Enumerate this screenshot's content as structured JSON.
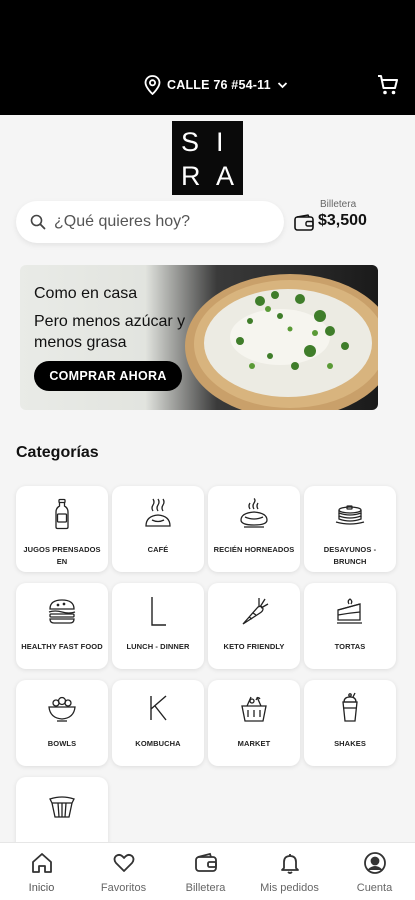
{
  "header": {
    "address": "CALLE 76 #54-11",
    "icons": {
      "location": "location-pin-icon",
      "dropdown": "chevron-down-icon",
      "cart": "shopping-cart-icon"
    }
  },
  "logo": {
    "letters": [
      "S",
      "I",
      "R",
      "A"
    ]
  },
  "search": {
    "placeholder": "¿Qué quieres hoy?"
  },
  "wallet": {
    "label": "Billetera",
    "amount": "$3,500"
  },
  "banner": {
    "line1": "Como en casa",
    "line2": "Pero menos azúcar y menos grasa",
    "cta": "COMPRAR AHORA"
  },
  "categories": {
    "title": "Categorías",
    "items": [
      {
        "label": "JUGOS PRENSADOS EN",
        "icon": "juice-bottle-icon"
      },
      {
        "label": "CAFÉ",
        "icon": "coffee-icon"
      },
      {
        "label": "RECIÉN HORNEADOS",
        "icon": "baked-pie-icon"
      },
      {
        "label": "DESAYUNOS - BRUNCH",
        "icon": "pancakes-icon"
      },
      {
        "label": "HEALTHY FAST FOOD",
        "icon": "burger-icon"
      },
      {
        "label": "LUNCH - DINNER",
        "icon": "letter-l-icon"
      },
      {
        "label": "KETO FRIENDLY",
        "icon": "carrot-icon"
      },
      {
        "label": "TORTAS",
        "icon": "cake-slice-icon"
      },
      {
        "label": "BOWLS",
        "icon": "salad-bowl-icon"
      },
      {
        "label": "KOMBUCHA",
        "icon": "letter-k-icon"
      },
      {
        "label": "MARKET",
        "icon": "market-basket-icon"
      },
      {
        "label": "SHAKES",
        "icon": "shake-icon"
      },
      {
        "label": "",
        "icon": "cupcake-icon"
      }
    ]
  },
  "nav": {
    "items": [
      {
        "label": "Inicio",
        "icon": "home-icon"
      },
      {
        "label": "Favoritos",
        "icon": "heart-icon"
      },
      {
        "label": "Billetera",
        "icon": "wallet-icon"
      },
      {
        "label": "Mis pedidos",
        "icon": "bell-icon"
      },
      {
        "label": "Cuenta",
        "icon": "user-circle-icon"
      }
    ],
    "active": "Inicio"
  }
}
